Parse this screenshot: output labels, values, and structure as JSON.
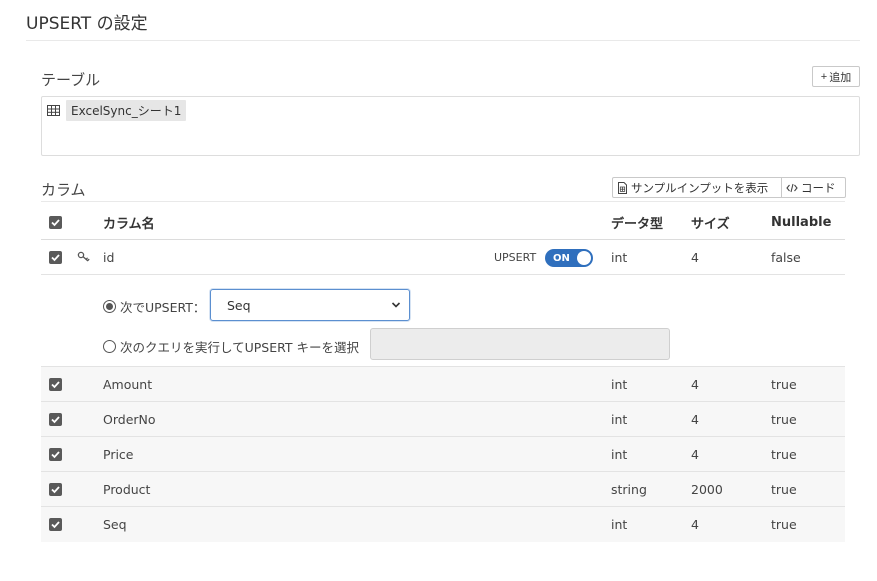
{
  "page": {
    "title": "UPSERT の設定"
  },
  "table_section": {
    "label": "テーブル",
    "add_button": "追加",
    "add_icon": "+",
    "selected_table": "ExcelSync_シート1"
  },
  "columns_section": {
    "label": "カラム",
    "sample_input_button": "サンプルインプットを表示",
    "code_button": "コード",
    "headers": {
      "name": "カラム名",
      "type": "データ型",
      "size": "サイズ",
      "nullable": "Nullable"
    },
    "key_row": {
      "name": "id",
      "upsert_label": "UPSERT",
      "toggle_label": "ON",
      "type": "int",
      "size": "4",
      "nullable": "false"
    },
    "upsert_options": {
      "option1_label": "次でUPSERT：",
      "selected_column": "Seq",
      "option2_label": "次のクエリを実行してUPSERT キーを選択"
    },
    "rows": [
      {
        "name": "Amount",
        "type": "int",
        "size": "4",
        "nullable": "true"
      },
      {
        "name": "OrderNo",
        "type": "int",
        "size": "4",
        "nullable": "true"
      },
      {
        "name": "Price",
        "type": "int",
        "size": "4",
        "nullable": "true"
      },
      {
        "name": "Product",
        "type": "string",
        "size": "2000",
        "nullable": "true"
      },
      {
        "name": "Seq",
        "type": "int",
        "size": "4",
        "nullable": "true"
      }
    ]
  },
  "colors": {
    "accent": "#2f6fbd",
    "checkbox": "#5a5a5a",
    "row_alt": "#f7f7f7"
  }
}
